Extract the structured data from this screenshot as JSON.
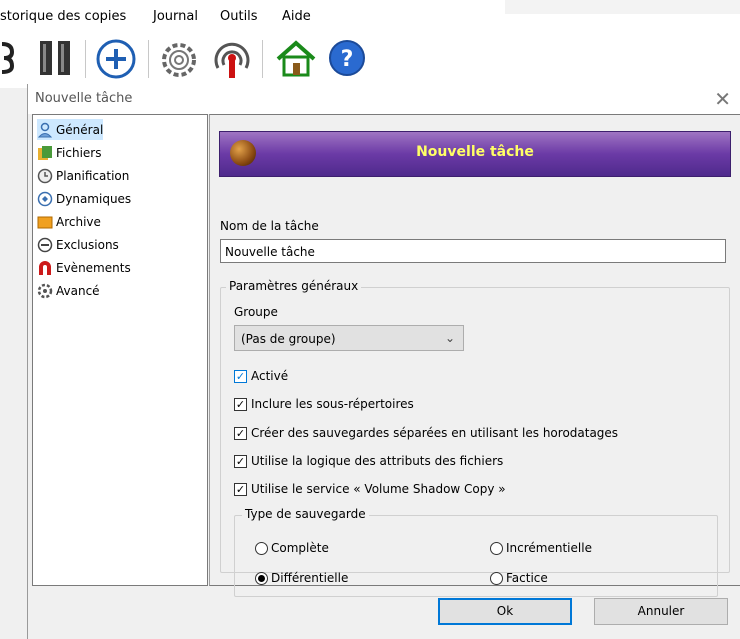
{
  "menu": {
    "items": [
      "storique des copies",
      "Journal",
      "Outils",
      "Aide"
    ]
  },
  "toolbar": {
    "icons": [
      "phone-icon",
      "columns-icon",
      "add-icon",
      "settings-icon",
      "broadcast-icon",
      "home-icon",
      "help-icon"
    ]
  },
  "dialog": {
    "title": "Nouvelle tâche",
    "close_glyph": "✕",
    "nav": [
      {
        "label": "Général",
        "icon": "user-icon",
        "selected": true
      },
      {
        "label": "Fichiers",
        "icon": "files-icon"
      },
      {
        "label": "Planification",
        "icon": "clock-icon"
      },
      {
        "label": "Dynamiques",
        "icon": "dynamic-icon"
      },
      {
        "label": "Archive",
        "icon": "archive-icon"
      },
      {
        "label": "Exclusions",
        "icon": "exclusion-icon"
      },
      {
        "label": "Evènements",
        "icon": "magnet-icon"
      },
      {
        "label": "Avancé",
        "icon": "gear-icon"
      }
    ],
    "banner_title": "Nouvelle tâche",
    "task_name_label": "Nom de la tâche",
    "task_name_value": "Nouvelle tâche",
    "general_group_title": "Paramètres généraux",
    "group_label": "Groupe",
    "group_value": "(Pas de groupe)",
    "checkboxes": [
      {
        "label": "Activé",
        "checked": true
      },
      {
        "label": "Inclure les sous-répertoires",
        "checked": true
      },
      {
        "label": "Créer des sauvegardes séparées en utilisant les horodatages",
        "checked": true
      },
      {
        "label": "Utilise la logique des attributs des fichiers",
        "checked": true
      },
      {
        "label": "Utilise le service « Volume Shadow Copy »",
        "checked": true
      }
    ],
    "backup_type_title": "Type de sauvegarde",
    "radios": [
      {
        "label": "Complète",
        "selected": false
      },
      {
        "label": "Incrémentielle",
        "selected": false
      },
      {
        "label": "Différentielle",
        "selected": true
      },
      {
        "label": "Factice",
        "selected": false
      }
    ],
    "ok_label": "Ok",
    "cancel_label": "Annuler"
  },
  "colors": {
    "banner_text": "#ffff66",
    "banner_bg": "#6b3aa6",
    "accent": "#0078d7",
    "selection": "#cde8ff"
  }
}
